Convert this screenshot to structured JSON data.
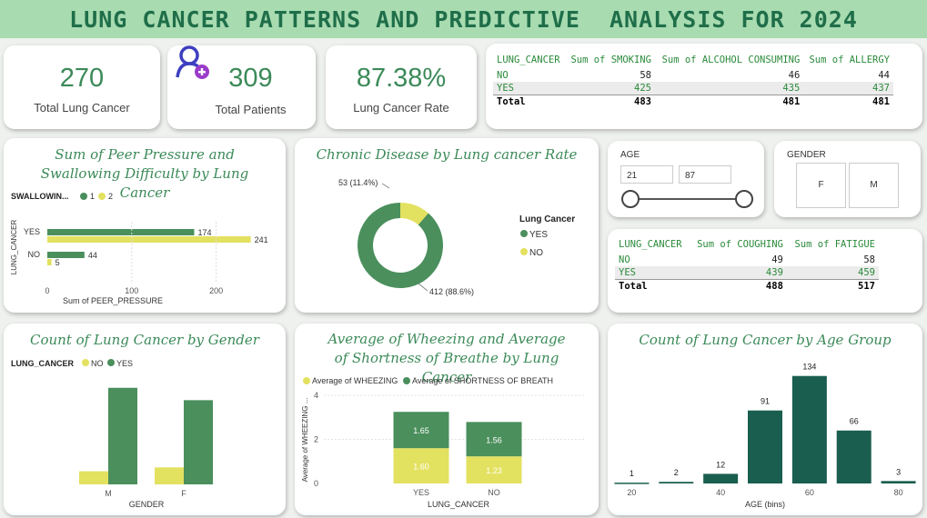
{
  "header": {
    "title": "LUNG CANCER PATTERNS AND PREDICTIVE  ANALYSIS FOR 2024"
  },
  "kpis": {
    "lung_cancer": {
      "value": "270",
      "label": "Total Lung Cancer"
    },
    "patients": {
      "value": "309",
      "label": "Total Patients"
    },
    "rate": {
      "value": "87.38%",
      "label": "Lung Cancer Rate"
    }
  },
  "table1": {
    "headers": [
      "LUNG_CANCER",
      "Sum of SMOKING",
      "Sum of ALCOHOL CONSUMING",
      "Sum of ALLERGY"
    ],
    "rows": [
      [
        "NO",
        "58",
        "46",
        "44"
      ],
      [
        "YES",
        "425",
        "435",
        "437"
      ],
      [
        "Total",
        "483",
        "481",
        "481"
      ]
    ]
  },
  "table2": {
    "headers": [
      "LUNG_CANCER",
      "Sum of COUGHING",
      "Sum of FATIGUE"
    ],
    "rows": [
      [
        "NO",
        "49",
        "58"
      ],
      [
        "YES",
        "439",
        "459"
      ],
      [
        "Total",
        "488",
        "517"
      ]
    ]
  },
  "age_slicer": {
    "title": "AGE",
    "min": "21",
    "max": "87"
  },
  "gender_slicer": {
    "title": "GENDER",
    "options": [
      "F",
      "M"
    ]
  },
  "colors": {
    "green": "#4a8f5c",
    "dark_green": "#1a5e4f",
    "yellow": "#e3e160",
    "title_green": "#3b8a58"
  },
  "chart_data": [
    {
      "id": "peer",
      "type": "bar",
      "orientation": "horizontal",
      "title": "Sum of Peer Pressure and Swallowing Difficulty by Lung Cancer",
      "legend_title": "SWALLOWIN...",
      "xlabel": "Sum of PEER_PRESSURE",
      "ylabel": "LUNG_CANCER",
      "categories": [
        "YES",
        "NO"
      ],
      "series": [
        {
          "name": "1",
          "values": [
            174,
            44
          ]
        },
        {
          "name": "2",
          "values": [
            241,
            5
          ]
        }
      ],
      "xlim": [
        0,
        250
      ],
      "xticks": [
        "0",
        "100",
        "200"
      ],
      "data_labels": [
        [
          "174",
          "44"
        ],
        [
          "241",
          "5"
        ]
      ]
    },
    {
      "id": "donut",
      "type": "pie",
      "donut": true,
      "title": "Chronic Disease by Lung cancer Rate",
      "legend_title": "Lung Cancer",
      "slices": [
        {
          "name": "YES",
          "value": 412,
          "label": "412 (88.6%)"
        },
        {
          "name": "NO",
          "value": 53,
          "label": "53 (11.4%)"
        }
      ]
    },
    {
      "id": "gender",
      "type": "bar",
      "title": "Count of Lung Cancer by Gender",
      "legend_title": "LUNG_CANCER",
      "xlabel": "GENDER",
      "categories": [
        "M",
        "F"
      ],
      "series": [
        {
          "name": "NO",
          "values": [
            17,
            22
          ]
        },
        {
          "name": "YES",
          "values": [
            125,
            109
          ]
        }
      ],
      "ylim": [
        0,
        140
      ]
    },
    {
      "id": "wheeze",
      "type": "bar",
      "stacked": true,
      "title": "Average of Wheezing and Average of Shortness of Breathe by Lung Cancer",
      "xlabel": "LUNG_CANCER",
      "ylabel": "Average of WHEEZING ...",
      "categories": [
        "YES",
        "NO"
      ],
      "series": [
        {
          "name": "Average of WHEEZING",
          "values": [
            1.6,
            1.23
          ],
          "labels": [
            "1.60",
            "1.23"
          ]
        },
        {
          "name": "Average of SHORTNESS OF BREATH",
          "values": [
            1.65,
            1.56
          ],
          "labels": [
            "1.65",
            "1.56"
          ]
        }
      ],
      "ylim": [
        0,
        4
      ],
      "yticks": [
        "0",
        "2",
        "4"
      ]
    },
    {
      "id": "age",
      "type": "bar",
      "title": "Count of Lung Cancer by Age Group",
      "xlabel": "AGE (bins)",
      "x": [
        20,
        30,
        40,
        50,
        60,
        70,
        80
      ],
      "values": [
        1,
        2,
        12,
        91,
        134,
        66,
        3
      ],
      "labels": [
        "1",
        "2",
        "12",
        "91",
        "134",
        "66",
        "3"
      ],
      "xticks": [
        "20",
        "40",
        "60",
        "80"
      ],
      "ylim": [
        0,
        145
      ]
    }
  ]
}
